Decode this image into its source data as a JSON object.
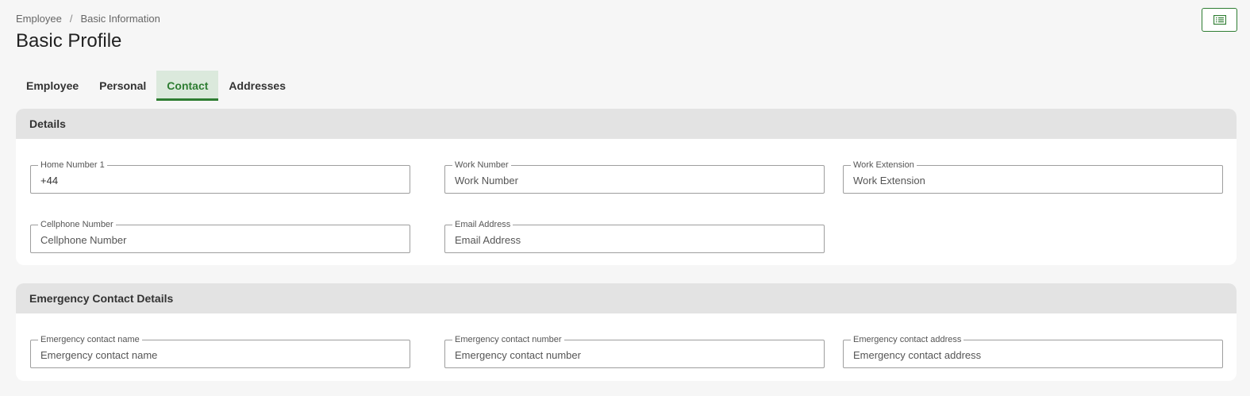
{
  "breadcrumb": {
    "items": [
      "Employee",
      "Basic Information"
    ],
    "separator": "/"
  },
  "page": {
    "title": "Basic Profile"
  },
  "corner_button": {
    "icon": "list-icon"
  },
  "tabs": [
    {
      "label": "Employee",
      "active": false
    },
    {
      "label": "Personal",
      "active": false
    },
    {
      "label": "Contact",
      "active": true
    },
    {
      "label": "Addresses",
      "active": false
    }
  ],
  "details": {
    "title": "Details",
    "fields": [
      {
        "label": "Home Number 1",
        "value": "+44",
        "placeholder": ""
      },
      {
        "label": "Work Number",
        "value": "",
        "placeholder": "Work Number"
      },
      {
        "label": "Work Extension",
        "value": "",
        "placeholder": "Work Extension"
      },
      {
        "label": "Cellphone Number",
        "value": "",
        "placeholder": "Cellphone Number"
      },
      {
        "label": "Email Address",
        "value": "",
        "placeholder": "Email Address"
      }
    ]
  },
  "emergency": {
    "title": "Emergency Contact Details",
    "fields": [
      {
        "label": "Emergency contact name",
        "value": "",
        "placeholder": "Emergency contact name"
      },
      {
        "label": "Emergency contact number",
        "value": "",
        "placeholder": "Emergency contact number"
      },
      {
        "label": "Emergency contact address",
        "value": "",
        "placeholder": "Emergency contact address"
      }
    ]
  },
  "colors": {
    "accent": "#2e7d32",
    "active_tab_bg": "#dbe9dc",
    "section_header_bg": "#e3e3e3",
    "page_bg": "#f6f6f6"
  }
}
